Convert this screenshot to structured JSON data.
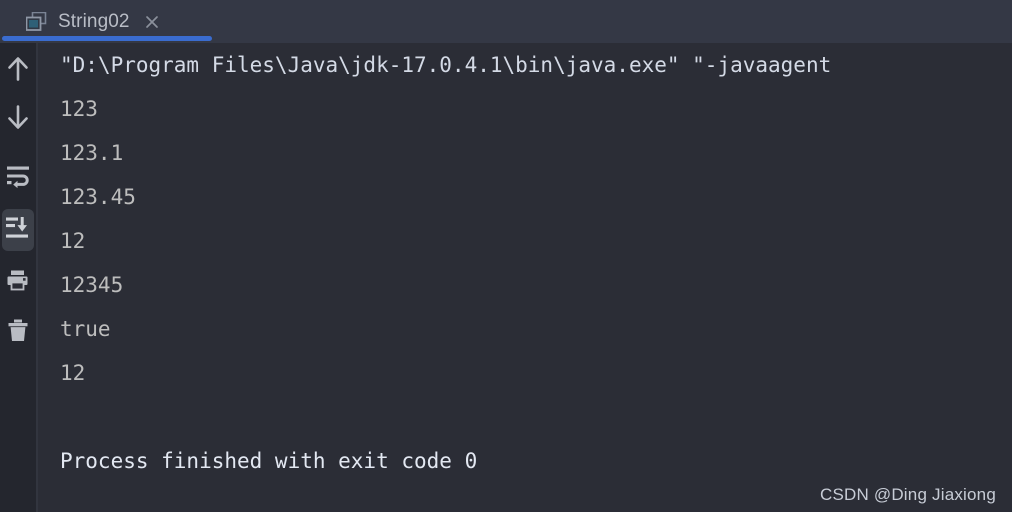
{
  "window": {
    "background_color": "#2b2d36",
    "tabbar_background_color": "#343845",
    "toolbar_background_color": "#24262e",
    "accent_color": "#3a6ccf"
  },
  "tabbar": {
    "tabs": [
      {
        "label": "String02",
        "icon": "console-window-icon",
        "close_icon": "close-icon",
        "active": true
      }
    ]
  },
  "toolbar": {
    "buttons": [
      {
        "name": "up-arrow-icon",
        "tooltip": "Up",
        "active": false
      },
      {
        "name": "down-arrow-icon",
        "tooltip": "Down",
        "active": false
      },
      {
        "name": "soft-wrap-icon",
        "tooltip": "Soft-Wrap",
        "active": false
      },
      {
        "name": "scroll-to-end-icon",
        "tooltip": "Scroll to End",
        "active": true
      },
      {
        "name": "print-icon",
        "tooltip": "Print",
        "active": false
      },
      {
        "name": "trash-icon",
        "tooltip": "Clear All",
        "active": false
      }
    ]
  },
  "console": {
    "lines": [
      {
        "text": "\"D:\\Program Files\\Java\\jdk-17.0.4.1\\bin\\java.exe\" \"-javaagent",
        "style": "cmd"
      },
      {
        "text": "123",
        "style": "out"
      },
      {
        "text": "123.1",
        "style": "out"
      },
      {
        "text": "123.45",
        "style": "out"
      },
      {
        "text": "12",
        "style": "out"
      },
      {
        "text": "12345",
        "style": "out"
      },
      {
        "text": "true",
        "style": "out"
      },
      {
        "text": "12",
        "style": "out"
      },
      {
        "text": " ",
        "style": "blank"
      },
      {
        "text": "Process finished with exit code 0",
        "style": "fin"
      }
    ]
  },
  "watermark": {
    "text": "CSDN @Ding Jiaxiong"
  }
}
